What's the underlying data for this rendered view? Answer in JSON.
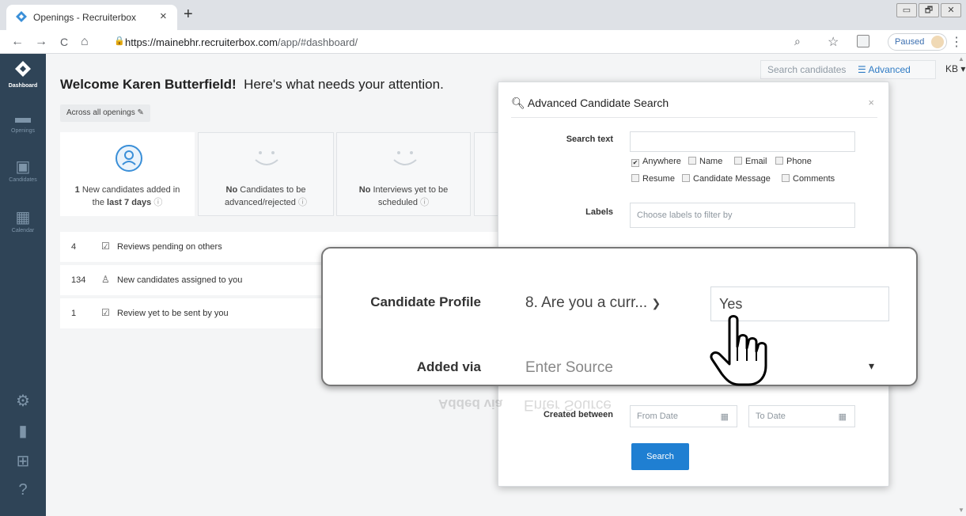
{
  "browser": {
    "tab_title": "Openings - Recruiterbox",
    "tab_close": "×",
    "new_tab": "+",
    "url_host": "https://mainebhr.recruiterbox.com",
    "url_path": "/app/#dashboard/",
    "back": "←",
    "forward": "→",
    "reload": "C",
    "home": "⌂",
    "profile_status": "Paused",
    "window_controls": [
      "▭",
      "🗗",
      "✕"
    ]
  },
  "sidebar": {
    "items": [
      {
        "label": "Dashboard",
        "icon": "logo-icon",
        "active": true
      },
      {
        "label": "Openings",
        "icon": "briefcase-icon"
      },
      {
        "label": "Candidates",
        "icon": "candidates-icon"
      },
      {
        "label": "Calendar",
        "icon": "calendar-icon"
      }
    ],
    "bottom_icons": [
      "gear-icon",
      "bar-chart-icon",
      "gift-icon",
      "help-icon"
    ],
    "help_glyph": "?"
  },
  "topbar": {
    "search_placeholder": "Search candidates",
    "advanced_label": "Advanced",
    "user_initials": "KB"
  },
  "dashboard": {
    "welcome_name": "Welcome Karen Butterfield!",
    "welcome_rest": "Here's what needs your attention.",
    "filter_chip": "Across all openings",
    "cards": [
      {
        "bold": "1",
        "text": " New candidates added in",
        "line2_pre": "the ",
        "line2_bold": "last 7 days"
      },
      {
        "bold": "No",
        "text": " Candidates to be",
        "line2_pre": "advanced/rejected",
        "line2_bold": ""
      },
      {
        "bold": "No",
        "text": " Interviews yet to be",
        "line2_pre": "scheduled",
        "line2_bold": ""
      }
    ],
    "tasks": [
      {
        "count": "4",
        "label": "Reviews pending on others"
      },
      {
        "count": "134",
        "label": "New candidates assigned to you"
      },
      {
        "count": "1",
        "label": "Review yet to be sent by you"
      }
    ]
  },
  "modal": {
    "title": "Advanced Candidate Search",
    "close": "×",
    "search_text_label": "Search text",
    "scope_options": [
      {
        "label": "Anywhere",
        "checked": true
      },
      {
        "label": "Name",
        "checked": false
      },
      {
        "label": "Email",
        "checked": false
      },
      {
        "label": "Phone",
        "checked": false
      },
      {
        "label": "Resume",
        "checked": false
      },
      {
        "label": "Candidate Message",
        "checked": false
      },
      {
        "label": "Comments",
        "checked": false
      }
    ],
    "labels_label": "Labels",
    "labels_placeholder": "Choose labels to filter by",
    "created_label": "Created between",
    "from_placeholder": "From Date",
    "to_placeholder": "To Date",
    "search_button": "Search"
  },
  "callout": {
    "profile_label": "Candidate Profile",
    "question": "8. Are you a curr...",
    "answer": "Yes",
    "added_via_label": "Added via",
    "source_placeholder": "Enter Source"
  },
  "colors": {
    "sidebar_bg": "#2f4457",
    "accent": "#1f7fd2",
    "logo": "#3a8fd8"
  }
}
